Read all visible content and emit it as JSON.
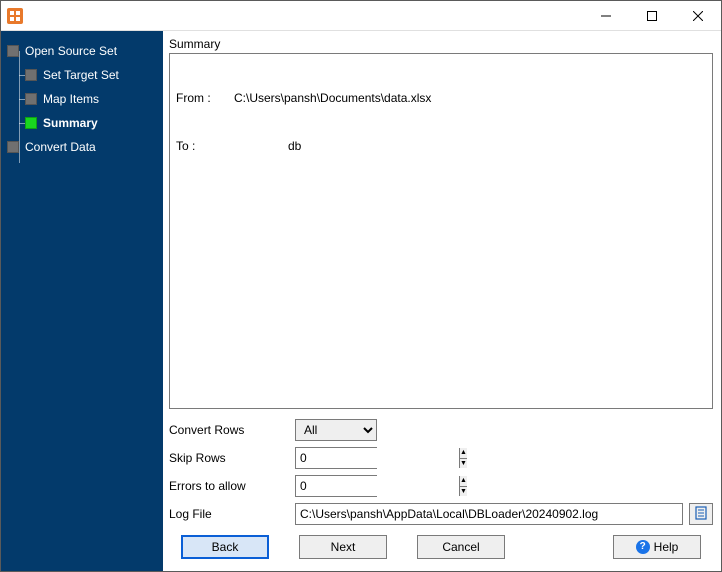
{
  "titlebar": {
    "title": ""
  },
  "sidebar": {
    "items": [
      {
        "label": "Open Source Set",
        "active": false,
        "indent": 0
      },
      {
        "label": "Set Target Set",
        "active": false,
        "indent": 1
      },
      {
        "label": "Map Items",
        "active": false,
        "indent": 1
      },
      {
        "label": "Summary",
        "active": true,
        "indent": 1
      },
      {
        "label": "Convert Data",
        "active": false,
        "indent": 0
      }
    ]
  },
  "section_title": "Summary",
  "summary": {
    "from_key": "From :",
    "from_val": "C:\\Users\\pansh\\Documents\\data.xlsx",
    "to_key": "To :",
    "to_val": "db"
  },
  "options": {
    "convert_rows_label": "Convert Rows",
    "convert_rows_value": "All",
    "skip_rows_label": "Skip Rows",
    "skip_rows_value": "0",
    "errors_label": "Errors to allow",
    "errors_value": "0",
    "logfile_label": "Log File",
    "logfile_value": "C:\\Users\\pansh\\AppData\\Local\\DBLoader\\20240902.log"
  },
  "buttons": {
    "back": "Back",
    "next": "Next",
    "cancel": "Cancel",
    "help": "Help"
  }
}
